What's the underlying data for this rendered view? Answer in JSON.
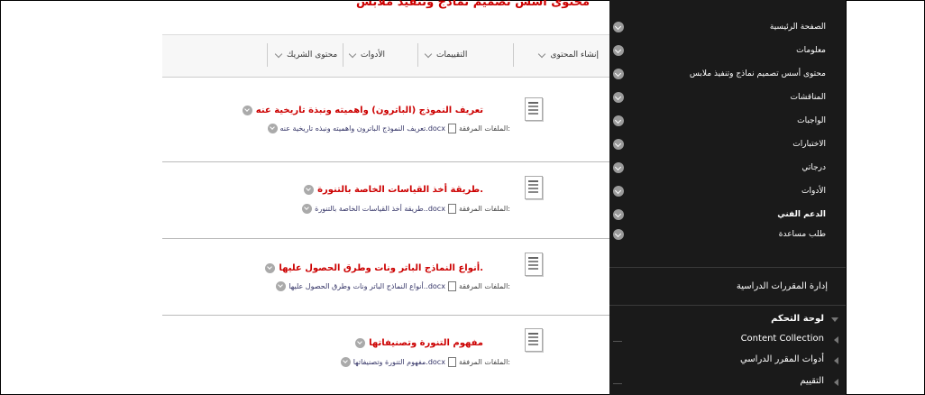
{
  "page_title": "محتوى أسس تصميم نماذج وتنفيذ ملابس",
  "toolbar": [
    {
      "label": "إنشاء المحتوى"
    },
    {
      "label": "التقييمات"
    },
    {
      "label": "الأدوات"
    },
    {
      "label": "محتوى الشريك"
    }
  ],
  "items": [
    {
      "title": "تعريف النموذج (الباترون) واهميته ونبذة تاريخية عنه",
      "attach_label": "الملفات المرفقة:",
      "file_name": "تعريف النموذج الباترون واهميته ونبذه تاريخية عنه.docx"
    },
    {
      "title": "طريقة أخذ القياسات الخاصة بالتنورة.",
      "attach_label": "الملفات المرفقة:",
      "file_name": "طريقة أخذ القياسات الخاصة بالتنورة..docx"
    },
    {
      "title": "أنواع النماذج الباتر ونات وطرق الحصول عليها.",
      "attach_label": "الملفات المرفقة:",
      "file_name": "أنواع النماذج الباتر ونات وطرق الحصول عليها..docx"
    },
    {
      "title": "مفهوم التنورة وتصنيفاتها",
      "attach_label": "الملفات المرفقة:",
      "file_name": "مفهوم التنورة وتصنيفاتها.docx"
    }
  ],
  "sidebar": {
    "menu": [
      {
        "label": "الصفحة الرئيسية"
      },
      {
        "label": "معلومات"
      },
      {
        "label": "محتوى أسس تصميم نماذج وتنفيذ ملابس"
      },
      {
        "label": "المناقشات"
      },
      {
        "label": "الواجبات"
      },
      {
        "label": "الاختبارات"
      },
      {
        "label": "درجاتي"
      },
      {
        "label": "الأدوات"
      },
      {
        "label": "الدعم الفني"
      },
      {
        "label": "طلب مساعدة"
      }
    ],
    "management_title": "إدارة المقررات الدراسية",
    "management": [
      {
        "label": "لوحة التحكم"
      },
      {
        "label": "Content Collection"
      },
      {
        "label": "أدوات المقرر الدراسي"
      },
      {
        "label": "التقييم"
      }
    ]
  }
}
